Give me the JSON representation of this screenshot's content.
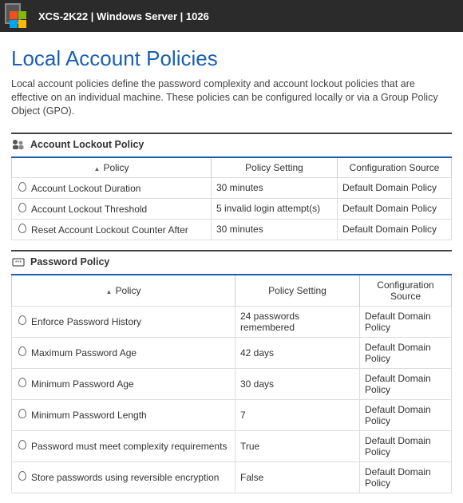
{
  "topbar": {
    "title": "XCS-2K22 | Windows Server | 1026"
  },
  "page": {
    "title": "Local Account Policies",
    "intro": "Local account policies define the password complexity and account lockout policies that are effective on an individual machine. These policies can be configured locally or via a Group Policy Object (GPO)."
  },
  "columns": {
    "policy": "Policy",
    "setting": "Policy Setting",
    "source": "Configuration Source"
  },
  "sections": [
    {
      "id": "lockout",
      "title": "Account Lockout Policy",
      "rows": [
        {
          "policy": "Account Lockout Duration",
          "setting": "30 minutes",
          "source": "Default Domain Policy"
        },
        {
          "policy": "Account Lockout Threshold",
          "setting": "5 invalid login attempt(s)",
          "source": "Default Domain Policy"
        },
        {
          "policy": "Reset Account Lockout Counter After",
          "setting": "30 minutes",
          "source": "Default Domain Policy"
        }
      ]
    },
    {
      "id": "password",
      "title": "Password Policy",
      "rows": [
        {
          "policy": "Enforce Password History",
          "setting": "24 passwords remembered",
          "source": "Default Domain Policy"
        },
        {
          "policy": "Maximum Password Age",
          "setting": "42 days",
          "source": "Default Domain Policy"
        },
        {
          "policy": "Minimum Password Age",
          "setting": "30 days",
          "source": "Default Domain Policy"
        },
        {
          "policy": "Minimum Password Length",
          "setting": "7",
          "source": "Default Domain Policy"
        },
        {
          "policy": "Password must meet complexity requirements",
          "setting": "True",
          "source": "Default Domain Policy"
        },
        {
          "policy": "Store passwords using reversible encryption",
          "setting": "False",
          "source": "Default Domain Policy"
        }
      ]
    }
  ]
}
